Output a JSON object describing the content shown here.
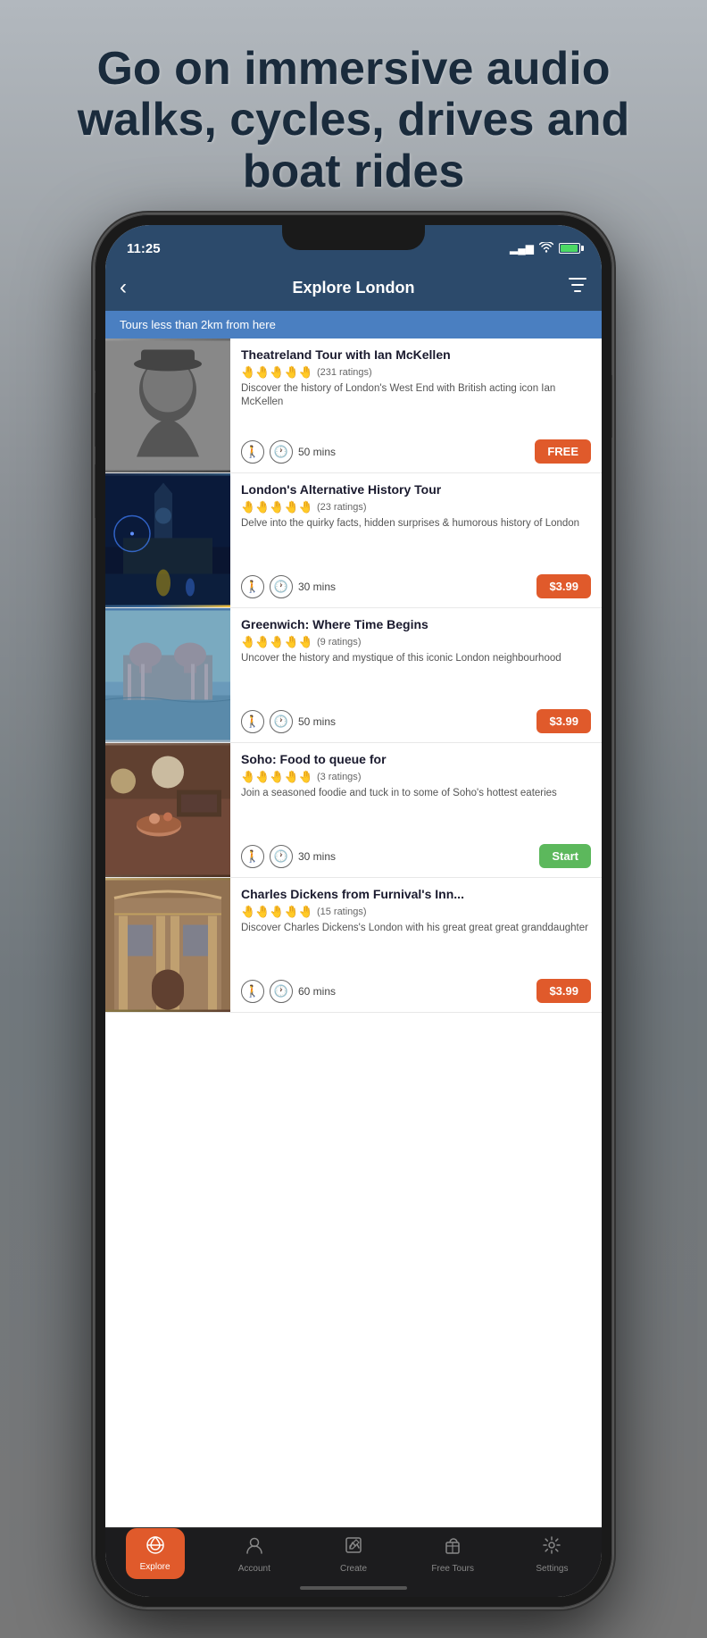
{
  "hero": {
    "title": "Go on immersive audio walks, cycles, drives and boat rides"
  },
  "status_bar": {
    "time": "11:25",
    "signal": "▂▄▆",
    "wifi": "wifi",
    "battery": "85"
  },
  "header": {
    "back_label": "‹",
    "title": "Explore London",
    "filter_icon": "⛉"
  },
  "location_banner": {
    "text": "Tours less than 2km from here"
  },
  "tours": [
    {
      "id": 1,
      "name": "Theatreland Tour with Ian McKellen",
      "ratings_count": "231 ratings",
      "description": "Discover the history of London's West End with British acting icon Ian McKellen",
      "duration": "50 mins",
      "price": "FREE",
      "price_type": "free"
    },
    {
      "id": 2,
      "name": "London's Alternative History Tour",
      "ratings_count": "23 ratings",
      "description": "Delve into the quirky facts, hidden surprises & humorous history of London",
      "duration": "30 mins",
      "price": "$3.99",
      "price_type": "paid"
    },
    {
      "id": 3,
      "name": "Greenwich: Where Time Begins",
      "ratings_count": "9 ratings",
      "description": "Uncover the history and mystique of this iconic London neighbourhood",
      "duration": "50 mins",
      "price": "$3.99",
      "price_type": "paid"
    },
    {
      "id": 4,
      "name": "Soho: Food to queue for",
      "ratings_count": "3 ratings",
      "description": "Join a seasoned foodie and tuck in to some of Soho's hottest eateries",
      "duration": "30 mins",
      "price": "Start",
      "price_type": "start"
    },
    {
      "id": 5,
      "name": "Charles Dickens from Furnival's Inn...",
      "ratings_count": "15 ratings",
      "description": "Discover Charles Dickens's London with his great great great granddaughter",
      "duration": "60 mins",
      "price": "$3.99",
      "price_type": "paid"
    }
  ],
  "bottom_nav": {
    "items": [
      {
        "id": "explore",
        "label": "Explore",
        "icon": "🗺",
        "active": true
      },
      {
        "id": "account",
        "label": "Account",
        "icon": "👤",
        "active": false
      },
      {
        "id": "create",
        "label": "Create",
        "icon": "✏",
        "active": false
      },
      {
        "id": "free-tours",
        "label": "Free Tours",
        "icon": "🎁",
        "active": false
      },
      {
        "id": "settings",
        "label": "Settings",
        "icon": "⚙",
        "active": false
      }
    ]
  }
}
